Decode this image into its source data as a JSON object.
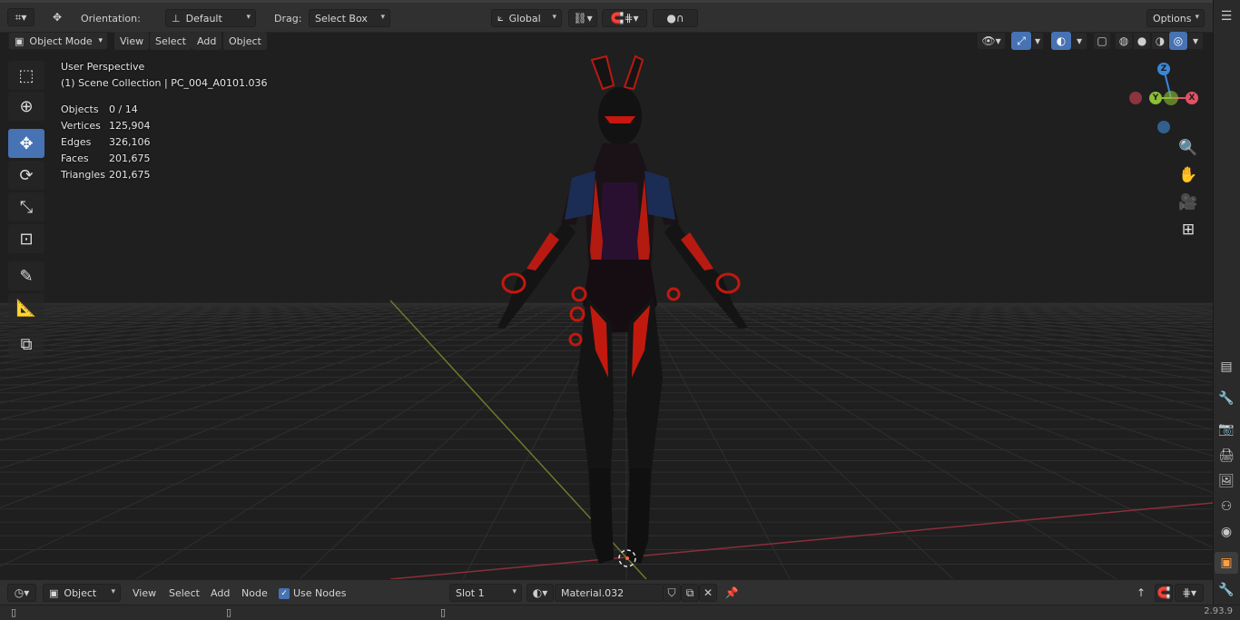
{
  "header": {
    "orientation_label": "Orientation:",
    "orientation_value": "Default",
    "drag_label": "Drag:",
    "drag_value": "Select Box",
    "transform_orientation": "Global",
    "options_label": "Options"
  },
  "viewport_header": {
    "mode": "Object Mode",
    "menus": [
      "View",
      "Select",
      "Add",
      "Object"
    ]
  },
  "overlay": {
    "perspective": "User Perspective",
    "collection": "(1) Scene Collection | PC_004_A0101.036",
    "stats": [
      {
        "key": "Objects",
        "value": "0 / 14"
      },
      {
        "key": "Vertices",
        "value": "125,904"
      },
      {
        "key": "Edges",
        "value": "326,106"
      },
      {
        "key": "Faces",
        "value": "201,675"
      },
      {
        "key": "Triangles",
        "value": "201,675"
      }
    ]
  },
  "gizmo": {
    "z": "Z",
    "y": "Y",
    "x": "X"
  },
  "shader_header": {
    "editor_type": "Object",
    "menus": [
      "View",
      "Select",
      "Add",
      "Node"
    ],
    "use_nodes_label": "Use Nodes",
    "slot": "Slot 1",
    "material": "Material.032"
  },
  "status": {
    "version": "2.93.9"
  },
  "icons": {
    "select_box": "select-box-icon",
    "cursor": "cursor-icon",
    "move": "move-icon",
    "rotate": "rotate-icon",
    "scale": "scale-icon",
    "transform": "transform-icon",
    "annotate": "annotate-icon",
    "measure": "measure-icon",
    "add_cube": "add-cube-icon"
  },
  "colors": {
    "accent": "#4772b3",
    "axis_x": "#e05264",
    "axis_y": "#8dbf33",
    "axis_z": "#3b86d6"
  }
}
